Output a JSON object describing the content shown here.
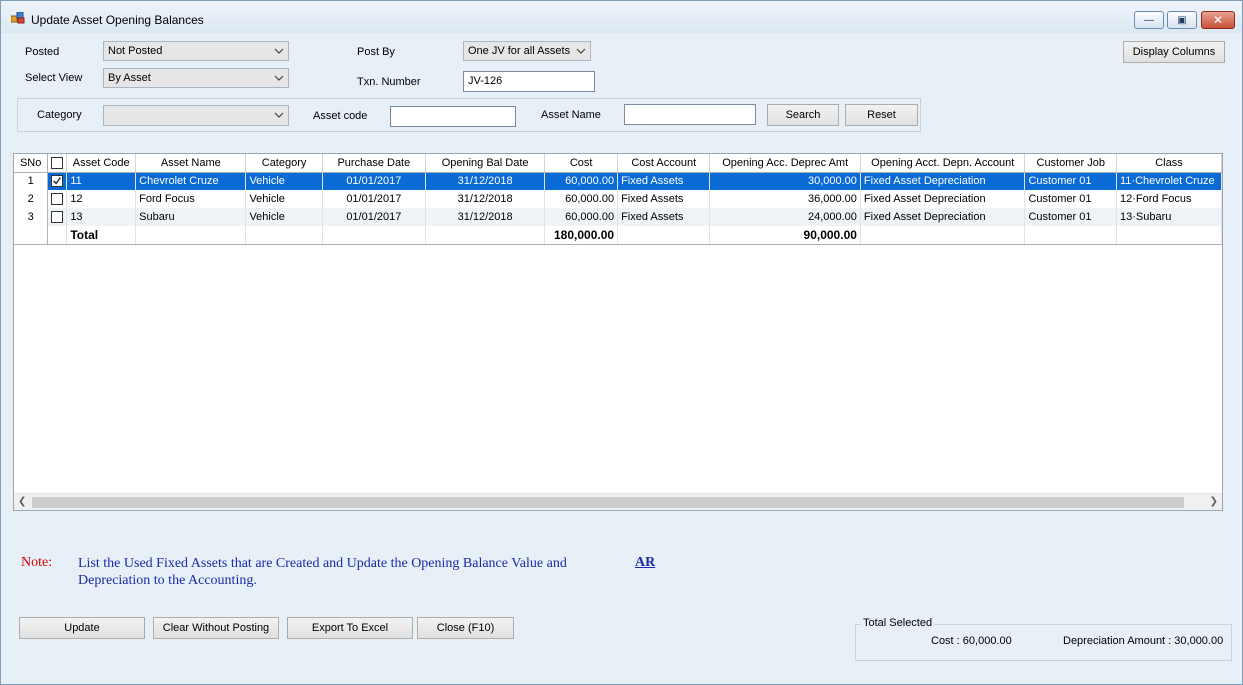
{
  "window": {
    "title": "Update Asset Opening Balances",
    "minimize_glyph": "—",
    "maximize_glyph": "▣",
    "close_glyph": "✕"
  },
  "filters": {
    "posted_label": "Posted",
    "posted_value": "Not Posted",
    "select_view_label": "Select View",
    "select_view_value": "By Asset",
    "post_by_label": "Post By",
    "post_by_value": "One JV for all Assets",
    "txn_number_label": "Txn. Number",
    "txn_number_value": "JV-126",
    "display_columns_label": "Display Columns"
  },
  "search": {
    "category_label": "Category",
    "category_value": "",
    "asset_code_label": "Asset code",
    "asset_code_value": "",
    "asset_name_label": "Asset Name",
    "asset_name_value": "",
    "search_label": "Search",
    "reset_label": "Reset"
  },
  "grid": {
    "headers": {
      "sno": "SNo",
      "asset_code": "Asset Code",
      "asset_name": "Asset Name",
      "category": "Category",
      "purchase_date": "Purchase Date",
      "opening_bal_date": "Opening Bal Date",
      "cost": "Cost",
      "cost_account": "Cost Account",
      "opening_acc_deprec_amt": "Opening Acc. Deprec Amt",
      "opening_acct_depn_account": "Opening Acct. Depn. Account",
      "customer_job": "Customer Job",
      "class": "Class"
    },
    "rows": [
      {
        "sno": "1",
        "checked": true,
        "asset_code": "11",
        "asset_name": "Chevrolet Cruze",
        "category": "Vehicle",
        "purchase_date": "01/01/2017",
        "opening_bal_date": "31/12/2018",
        "cost": "60,000.00",
        "cost_account": "Fixed Assets",
        "opening_acc_deprec_amt": "30,000.00",
        "opening_acct_depn_account": "Fixed Asset Depreciation",
        "customer_job": "Customer 01",
        "class": "11·Chevrolet Cruze"
      },
      {
        "sno": "2",
        "checked": false,
        "asset_code": "12",
        "asset_name": "Ford Focus",
        "category": "Vehicle",
        "purchase_date": "01/01/2017",
        "opening_bal_date": "31/12/2018",
        "cost": "60,000.00",
        "cost_account": "Fixed Assets",
        "opening_acc_deprec_amt": "36,000.00",
        "opening_acct_depn_account": "Fixed Asset Depreciation",
        "customer_job": "Customer 01",
        "class": "12·Ford Focus"
      },
      {
        "sno": "3",
        "checked": false,
        "asset_code": "13",
        "asset_name": "Subaru",
        "category": "Vehicle",
        "purchase_date": "01/01/2017",
        "opening_bal_date": "31/12/2018",
        "cost": "60,000.00",
        "cost_account": "Fixed Assets",
        "opening_acc_deprec_amt": "24,000.00",
        "opening_acct_depn_account": "Fixed Asset Depreciation",
        "customer_job": "Customer 01",
        "class": "13·Subaru"
      }
    ],
    "total": {
      "label": "Total",
      "cost": "180,000.00",
      "opening_acc_deprec_amt": "90,000.00"
    }
  },
  "note": {
    "label": "Note:",
    "text": "List the Used Fixed Assets that are Created and Update the Opening Balance Value and Depreciation to the Accounting.",
    "link": "AR"
  },
  "actions": {
    "update": "Update",
    "clear_without_posting": "Clear Without Posting",
    "export_to_excel": "Export To Excel",
    "close": "Close (F10)"
  },
  "total_selected": {
    "title": "Total Selected",
    "cost_text": "Cost : 60,000.00",
    "depreciation_text": "Depreciation Amount : 30,000.00"
  },
  "colors": {
    "selection": "#0a6ad6",
    "note_label": "#d40000",
    "note_text": "#1a2aa8"
  }
}
